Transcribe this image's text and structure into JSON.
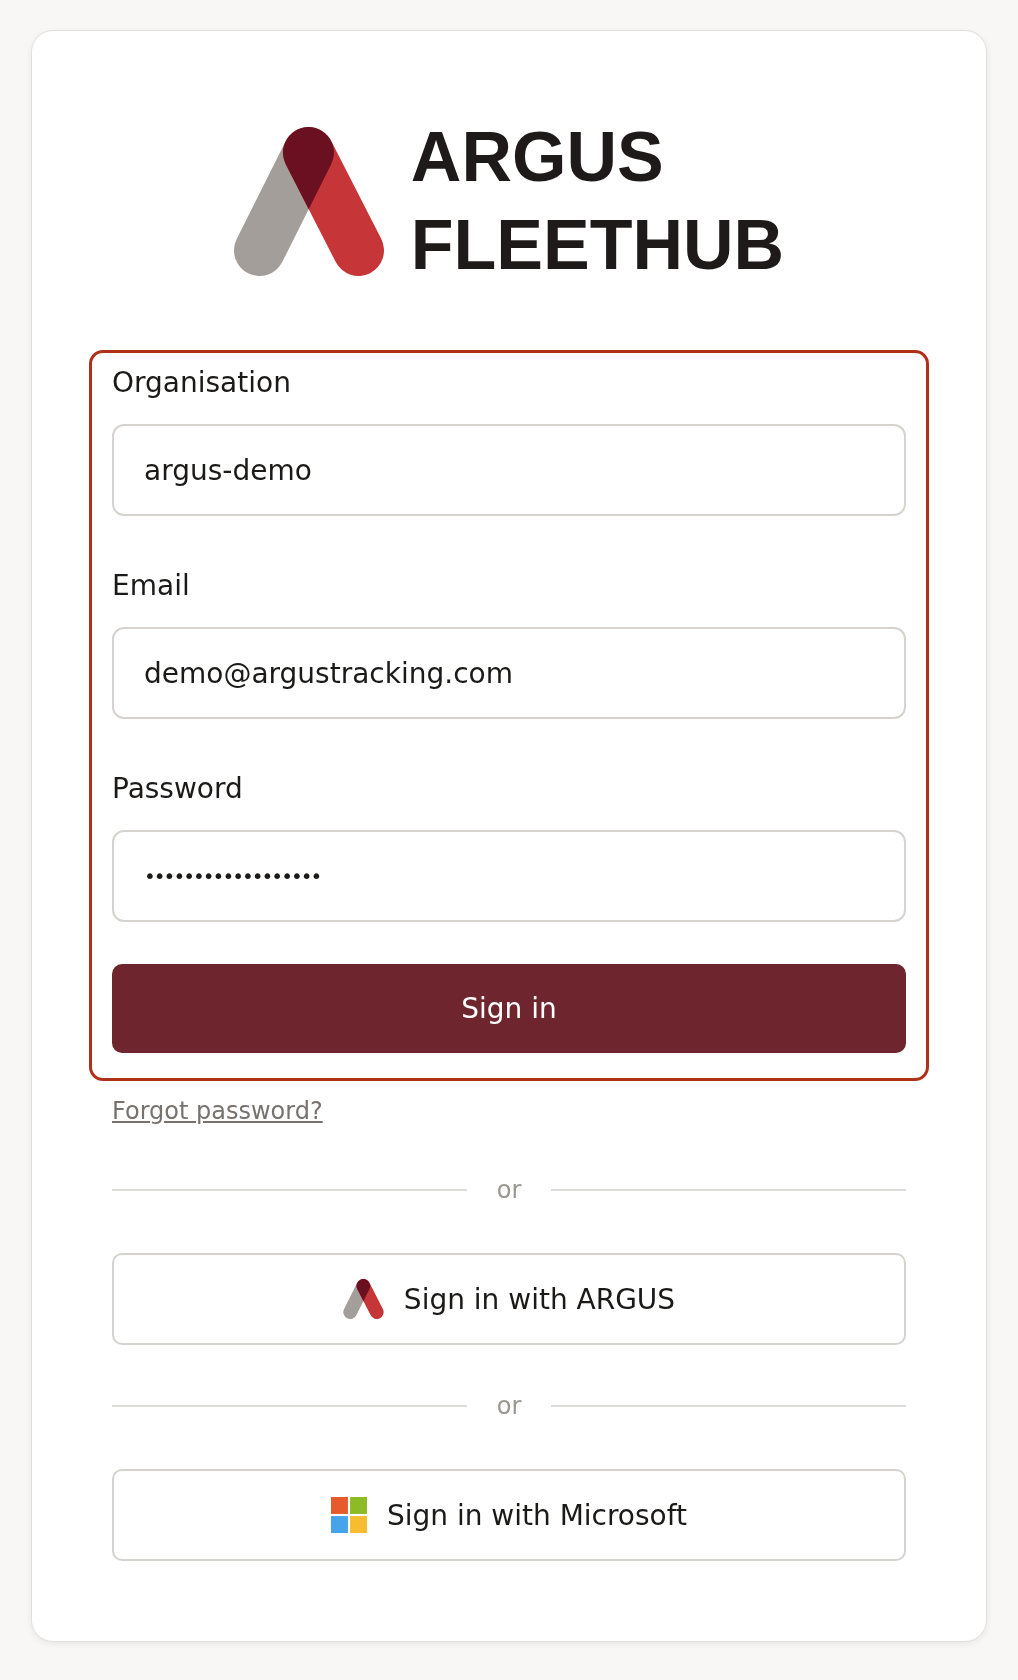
{
  "logo": {
    "name": "ARGUS",
    "product": "FLEETHUB"
  },
  "form": {
    "highlighted": true,
    "fields": [
      {
        "label": "Organisation",
        "value": "argus-demo",
        "kind": "text"
      },
      {
        "label": "Email",
        "value": "demo@argustracking.com",
        "kind": "text"
      },
      {
        "label": "Password",
        "value": "••••••••••••••••••",
        "kind": "password"
      }
    ],
    "submit": "Sign in"
  },
  "forgot_link": "Forgot password?",
  "alternatives": [
    {
      "separator": "or",
      "label": "Sign in with ARGUS",
      "kind": "argus"
    },
    {
      "separator": "or",
      "label": "Sign in with Microsoft",
      "kind": "microsoft"
    }
  ]
}
